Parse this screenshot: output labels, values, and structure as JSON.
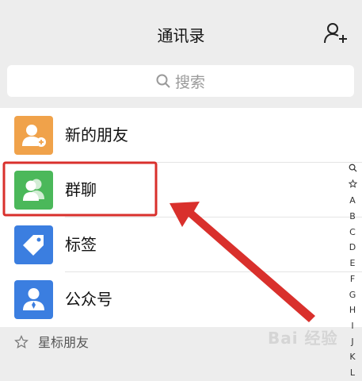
{
  "header": {
    "title": "通讯录",
    "add_icon": "add-contact-icon"
  },
  "search": {
    "placeholder": "搜索",
    "icon": "search-icon"
  },
  "items": [
    {
      "label": "新的朋友",
      "icon": "new-friend-icon",
      "color": "#f0a24a"
    },
    {
      "label": "群聊",
      "icon": "group-chat-icon",
      "color": "#4bb85a"
    },
    {
      "label": "标签",
      "icon": "tag-icon",
      "color": "#3b7ee0"
    },
    {
      "label": "公众号",
      "icon": "official-account-icon",
      "color": "#3b7ee0"
    }
  ],
  "section": {
    "label": "星标朋友",
    "icon": "star-icon"
  },
  "index": [
    "A",
    "B",
    "C",
    "D",
    "E",
    "F",
    "G",
    "H",
    "I",
    "J",
    "K",
    "L"
  ],
  "index_icons": [
    "search-icon",
    "star-icon"
  ],
  "annotation": {
    "highlight_color": "#d9302c",
    "target": "群聊"
  },
  "watermark": "Bai 经验"
}
